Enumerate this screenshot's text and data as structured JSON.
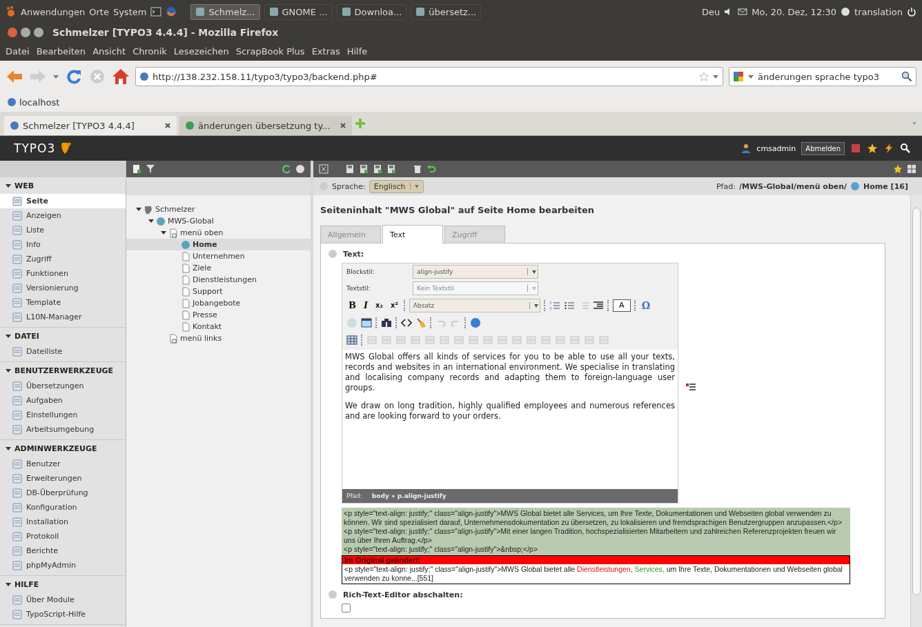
{
  "panel": {
    "menus": [
      "Anwendungen",
      "Orte",
      "System"
    ],
    "tasks": [
      {
        "label": "Schmelz...",
        "selected": true
      },
      {
        "label": "GNOME ...",
        "selected": false
      },
      {
        "label": "Downloa...",
        "selected": false
      },
      {
        "label": "übersetz...",
        "selected": false
      }
    ],
    "keyboard": "Deu",
    "datetime": "Mo, 20. Dez, 12:30",
    "user": "translation"
  },
  "window": {
    "title": "Schmelzer [TYPO3 4.4.4] - Mozilla Firefox"
  },
  "menubar": [
    "Datei",
    "Bearbeiten",
    "Ansicht",
    "Chronik",
    "Lesezeichen",
    "ScrapBook Plus",
    "Extras",
    "Hilfe"
  ],
  "address": {
    "value": "http://138.232.158.11/typo3/typo3/backend.php#"
  },
  "search": {
    "value": "änderungen sprache typo3"
  },
  "bookmarks": [
    "localhost"
  ],
  "tabs": [
    {
      "label": "Schmelzer [TYPO3 4.4.4]",
      "selected": true
    },
    {
      "label": "änderungen übersetzung ty...",
      "selected": false
    }
  ],
  "typo3": {
    "logo": "TYPO3",
    "user": "cmsadmin",
    "logout": "Abmelden"
  },
  "modules": [
    {
      "title": "WEB",
      "expanded": true,
      "items": [
        {
          "label": "Seite",
          "selected": true
        },
        {
          "label": "Anzeigen",
          "selected": false
        },
        {
          "label": "Liste",
          "selected": false
        },
        {
          "label": "Info",
          "selected": false
        },
        {
          "label": "Zugriff",
          "selected": false
        },
        {
          "label": "Funktionen",
          "selected": false
        },
        {
          "label": "Versionierung",
          "selected": false
        },
        {
          "label": "Template",
          "selected": false
        },
        {
          "label": "L10N-Manager",
          "selected": false
        }
      ]
    },
    {
      "title": "DATEI",
      "expanded": true,
      "items": [
        {
          "label": "Dateiliste",
          "selected": false
        }
      ]
    },
    {
      "title": "BENUTZERWERKZEUGE",
      "expanded": true,
      "items": [
        {
          "label": "Übersetzungen",
          "selected": false
        },
        {
          "label": "Aufgaben",
          "selected": false
        },
        {
          "label": "Einstellungen",
          "selected": false
        },
        {
          "label": "Arbeitsumgebung",
          "selected": false
        }
      ]
    },
    {
      "title": "ADMINWERKZEUGE",
      "expanded": true,
      "items": [
        {
          "label": "Benutzer",
          "selected": false
        },
        {
          "label": "Erweiterungen",
          "selected": false
        },
        {
          "label": "DB-Überprüfung",
          "selected": false
        },
        {
          "label": "Konfiguration",
          "selected": false
        },
        {
          "label": "Installation",
          "selected": false
        },
        {
          "label": "Protokoll",
          "selected": false
        },
        {
          "label": "Berichte",
          "selected": false
        },
        {
          "label": "phpMyAdmin",
          "selected": false
        }
      ]
    },
    {
      "title": "HILFE",
      "expanded": true,
      "items": [
        {
          "label": "Über Module",
          "selected": false
        },
        {
          "label": "TypoScript-Hilfe",
          "selected": false
        }
      ]
    }
  ],
  "tree": [
    {
      "label": "Schmelzer",
      "kind": "root",
      "selected": false,
      "expanded": true,
      "children": [
        {
          "label": "MWS-Global",
          "kind": "site",
          "selected": false,
          "expanded": true,
          "children": [
            {
              "label": "menü oben",
              "kind": "folder",
              "selected": false,
              "expanded": true,
              "children": [
                {
                  "label": "Home",
                  "kind": "site",
                  "selected": true
                },
                {
                  "label": "Unternehmen",
                  "kind": "page",
                  "selected": false
                },
                {
                  "label": "Ziele",
                  "kind": "page",
                  "selected": false
                },
                {
                  "label": "Dienstleistungen",
                  "kind": "page",
                  "selected": false
                },
                {
                  "label": "Support",
                  "kind": "page",
                  "selected": false
                },
                {
                  "label": "Jobangebote",
                  "kind": "page",
                  "selected": false
                },
                {
                  "label": "Presse",
                  "kind": "page",
                  "selected": false
                },
                {
                  "label": "Kontakt",
                  "kind": "page",
                  "selected": false
                }
              ]
            },
            {
              "label": "menü links",
              "kind": "folder",
              "selected": false
            }
          ]
        }
      ]
    }
  ],
  "doc": {
    "language_label": "Sprache:",
    "language": "Englisch",
    "path_label": "Pfad:",
    "path": "/MWS-Global/menü oben/",
    "page": "Home [16]",
    "heading": "Seiteninhalt \"MWS Global\" auf Seite Home bearbeiten",
    "tabs": [
      {
        "label": "Allgemein",
        "selected": false
      },
      {
        "label": "Text",
        "selected": true
      },
      {
        "label": "Zugriff",
        "selected": false
      }
    ],
    "field_label": "Text:",
    "rte": {
      "block_label": "Blockstil:",
      "block_value": "align-justify",
      "text_label": "Textstil:",
      "text_value": "Kein Textstil",
      "text_disabled": true,
      "buttons": [
        "B",
        "I",
        "x₂",
        "x²"
      ],
      "format": "Absatz",
      "char_button": "Ω",
      "color_button": "A",
      "paragraphs": [
        "MWS Global offers all kinds of services for you to be able to use all your texts, records and websites in an international environment. We specialise in translating and localising company records and adapting them to foreign-language user groups.",
        "We draw on long tradition, highly qualified employees and numerous references and are looking forward to your orders."
      ],
      "status_label": "Pfad:",
      "status_path": "body » p.align-justify"
    },
    "original_lines": [
      "<p style=\"text-align: justify;\" class=\"align-justify\">MWS Global bietet alle Services, um Ihre Texte, Dokumentationen und Webseiten global verwenden zu können. Wir sind spezialisiert darauf, Unternehmensdokumentation zu übersetzen, zu lokalisieren und fremdsprachigen Benutzergruppen anzupassen.</p>",
      "<p style=\"text-align: justify;\" class=\"align-justify\">Mit einer langen Tradition, hochspezialisierten Mitarbeitern und zahlreichen Referenzprojekten freuen wir uns über Ihren Auftrag.</p>",
      "<p style=\"text-align: justify;\" class=\"align-justify\">&nbsp;</p>"
    ],
    "changed_title": "Im Original geändert:",
    "changed": [
      {
        "kind": "plain",
        "text": "<p style=\"text-align: justify;\" class=\"align-justify\">MWS Global bietet alle "
      },
      {
        "kind": "removed",
        "text": "Dienstleistungen,"
      },
      {
        "kind": "added",
        "text": " Services,"
      },
      {
        "kind": "plain",
        "text": " um Ihre Texte, Dokumentationen und Webseiten global verwenden zu konne...[551]"
      }
    ],
    "rte_off_label": "Rich-Text-Editor abschalten:",
    "rte_off": false
  }
}
